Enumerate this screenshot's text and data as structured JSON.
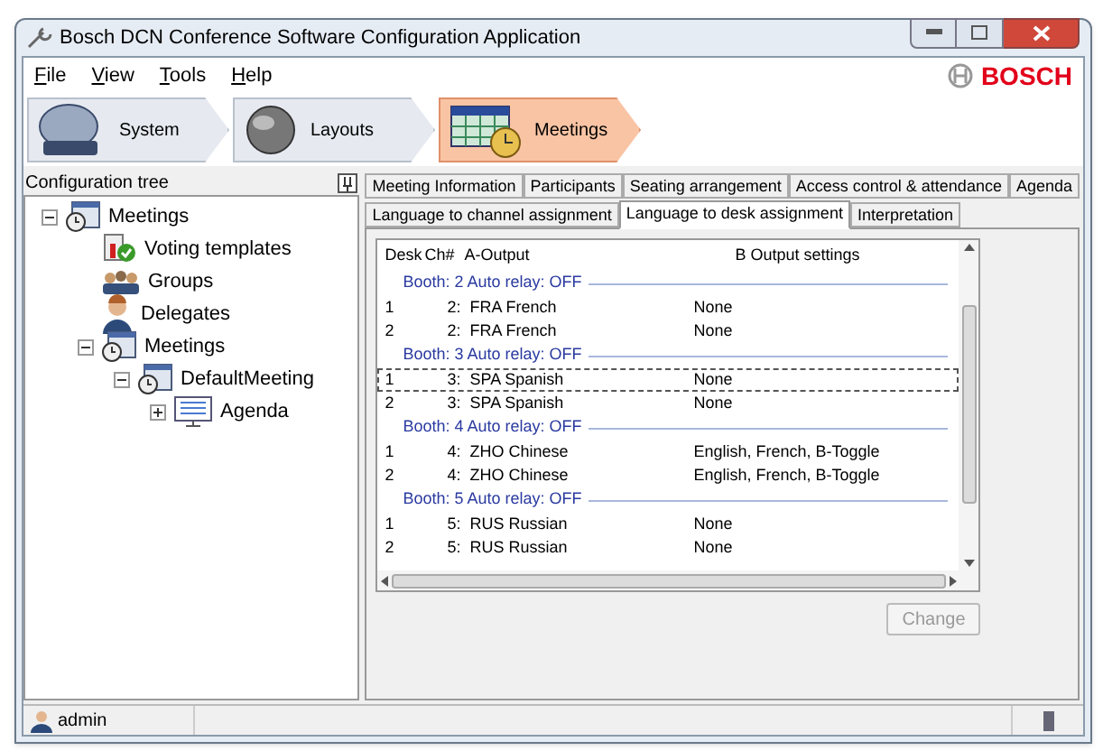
{
  "window": {
    "title": "Bosch DCN Conference Software Configuration Application",
    "brand": "BOSCH"
  },
  "menu": [
    "File",
    "View",
    "Tools",
    "Help"
  ],
  "nav": [
    {
      "label": "System",
      "selected": false,
      "kind": "system"
    },
    {
      "label": "Layouts",
      "selected": false,
      "kind": "layouts"
    },
    {
      "label": "Meetings",
      "selected": true,
      "kind": "meetings"
    }
  ],
  "tree": {
    "title": "Configuration tree",
    "items": [
      {
        "label": "Meetings",
        "kind": "meetings",
        "expanded": true,
        "children": [
          {
            "label": "Voting templates",
            "kind": "voting"
          },
          {
            "label": "Groups",
            "kind": "groups"
          },
          {
            "label": "Delegates",
            "kind": "person"
          },
          {
            "label": "Meetings",
            "kind": "meetings",
            "expanded": true,
            "children": [
              {
                "label": "DefaultMeeting",
                "kind": "meeting",
                "expanded": true,
                "children": [
                  {
                    "label": "Agenda",
                    "kind": "agenda",
                    "expanded": false
                  }
                ]
              }
            ]
          }
        ]
      }
    ]
  },
  "tabs_row_1": [
    {
      "label": "Meeting Information",
      "selected": false
    },
    {
      "label": "Participants",
      "selected": false
    },
    {
      "label": "Seating arrangement",
      "selected": false
    },
    {
      "label": "Access control & attendance",
      "selected": false
    },
    {
      "label": "Agenda",
      "selected": false
    }
  ],
  "tabs_row_2": [
    {
      "label": "Language to channel assignment",
      "selected": false
    },
    {
      "label": "Language to desk assignment",
      "selected": true
    },
    {
      "label": "Interpretation",
      "selected": false
    }
  ],
  "table": {
    "columns": [
      "Desk",
      "Ch#",
      "A-Output",
      "B Output settings"
    ],
    "groups": [
      {
        "title": "Booth: 2 Auto relay: OFF",
        "rows": [
          {
            "desk": "1",
            "ch": "2:",
            "a_output": "FRA French",
            "b_output": "None",
            "selected": false
          },
          {
            "desk": "2",
            "ch": "2:",
            "a_output": "FRA French",
            "b_output": "None",
            "selected": false
          }
        ]
      },
      {
        "title": "Booth: 3 Auto relay: OFF",
        "rows": [
          {
            "desk": "1",
            "ch": "3:",
            "a_output": "SPA Spanish",
            "b_output": "None",
            "selected": true
          },
          {
            "desk": "2",
            "ch": "3:",
            "a_output": "SPA Spanish",
            "b_output": "None",
            "selected": false
          }
        ]
      },
      {
        "title": "Booth: 4 Auto relay: OFF",
        "rows": [
          {
            "desk": "1",
            "ch": "4:",
            "a_output": "ZHO Chinese",
            "b_output": "English, French, B-Toggle",
            "selected": false
          },
          {
            "desk": "2",
            "ch": "4:",
            "a_output": "ZHO Chinese",
            "b_output": "English, French, B-Toggle",
            "selected": false
          }
        ]
      },
      {
        "title": "Booth: 5 Auto relay: OFF",
        "rows": [
          {
            "desk": "1",
            "ch": "5:",
            "a_output": "RUS Russian",
            "b_output": "None",
            "selected": false
          },
          {
            "desk": "2",
            "ch": "5:",
            "a_output": "RUS Russian",
            "b_output": "None",
            "selected": false
          }
        ]
      }
    ]
  },
  "change_button": {
    "label": "Change",
    "disabled": true
  },
  "status_bar": {
    "user": "admin"
  }
}
